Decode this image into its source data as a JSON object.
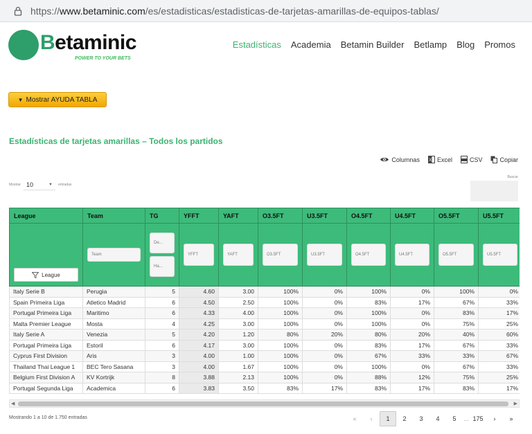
{
  "browser": {
    "url_prefix": "https://",
    "url_host": "www.betaminic.com",
    "url_path": "/es/estadisticas/estadisticas-de-tarjetas-amarillas-de-equipos-tablas/"
  },
  "logo": {
    "text": "Betaminic",
    "tagline": "POWER TO YOUR BETS"
  },
  "nav": [
    "Estadísticas",
    "Academia",
    "Betamin Builder",
    "Betlamp",
    "Blog",
    "Promos"
  ],
  "help_button": "Mostrar AYUDA TABLA",
  "section_title": "Estadísticas de tarjetas amarillas – Todos los partidos",
  "exports": {
    "columns": "Columnas",
    "excel": "Excel",
    "csv": "CSV",
    "copy": "Copiar"
  },
  "length": {
    "show": "Mostrar",
    "value": "10",
    "entries": "entradas"
  },
  "search_label": "Buscar",
  "table": {
    "headers": [
      "League",
      "Team",
      "TG",
      "YFFT",
      "YAFT",
      "O3.5FT",
      "U3.5FT",
      "O4.5FT",
      "U4.5FT",
      "O5.5FT",
      "U5.5FT"
    ],
    "filters": {
      "league": "League",
      "team": "Team",
      "tg_from": "De...",
      "tg_to": "Ha...",
      "yfft": "YFFT",
      "yaft": "YAFT",
      "o35": "O3.5FT",
      "u35": "U3.5FT",
      "o45": "O4.5FT",
      "u45": "U4.5FT",
      "o55": "O5.5FT",
      "u55": "U5.5FT"
    },
    "rows": [
      [
        "Italy Serie B",
        "Perugia",
        "5",
        "4.60",
        "3.00",
        "100%",
        "0%",
        "100%",
        "0%",
        "100%",
        "0%"
      ],
      [
        "Spain Primeira Liga",
        "Atletico Madrid",
        "6",
        "4.50",
        "2.50",
        "100%",
        "0%",
        "83%",
        "17%",
        "67%",
        "33%"
      ],
      [
        "Portugal Primeira Liga",
        "Maritimo",
        "6",
        "4.33",
        "4.00",
        "100%",
        "0%",
        "100%",
        "0%",
        "83%",
        "17%"
      ],
      [
        "Malta Premier League",
        "Mosta",
        "4",
        "4.25",
        "3.00",
        "100%",
        "0%",
        "100%",
        "0%",
        "75%",
        "25%"
      ],
      [
        "Italy Serie A",
        "Venezia",
        "5",
        "4.20",
        "1.20",
        "80%",
        "20%",
        "80%",
        "20%",
        "40%",
        "60%"
      ],
      [
        "Portugal Primeira Liga",
        "Estoril",
        "6",
        "4.17",
        "3.00",
        "100%",
        "0%",
        "83%",
        "17%",
        "67%",
        "33%"
      ],
      [
        "Cyprus First Division",
        "Aris",
        "3",
        "4.00",
        "1.00",
        "100%",
        "0%",
        "67%",
        "33%",
        "33%",
        "67%"
      ],
      [
        "Thailand Thai League 1",
        "BEC Tero Sasana",
        "3",
        "4.00",
        "1.67",
        "100%",
        "0%",
        "100%",
        "0%",
        "67%",
        "33%"
      ],
      [
        "Belgium First Division A",
        "KV Kortrijk",
        "8",
        "3.88",
        "2.13",
        "100%",
        "0%",
        "88%",
        "12%",
        "75%",
        "25%"
      ],
      [
        "Portugal Segunda Liga",
        "Academica",
        "6",
        "3.83",
        "3.50",
        "83%",
        "17%",
        "83%",
        "17%",
        "83%",
        "17%"
      ]
    ]
  },
  "info": "Mostrando 1 a 10 de 1.750 entradas",
  "pager": {
    "first": "«",
    "prev": "‹",
    "pages": [
      "1",
      "2",
      "3",
      "4",
      "5"
    ],
    "ellipsis": "...",
    "last_page": "175",
    "next": "›",
    "last": "»"
  }
}
